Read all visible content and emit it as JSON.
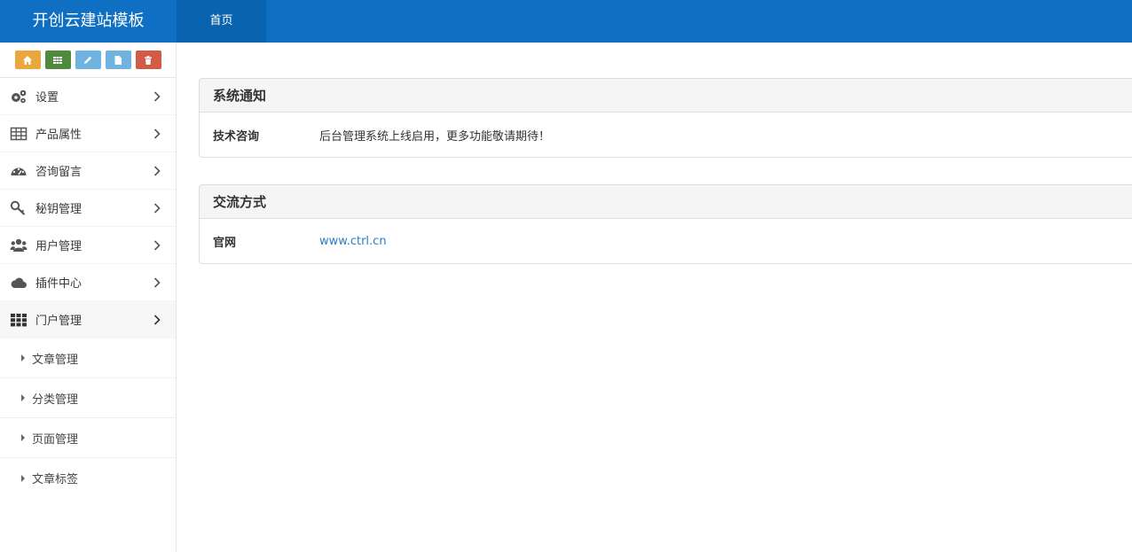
{
  "header": {
    "brand": "开创云建站模板",
    "nav": [
      {
        "label": "首页"
      }
    ]
  },
  "shortcuts": [
    {
      "icon": "home-icon",
      "color": "#e9a73e"
    },
    {
      "icon": "grid-icon",
      "color": "#4f8a3c"
    },
    {
      "icon": "pencil-icon",
      "color": "#6fb3e0"
    },
    {
      "icon": "file-icon",
      "color": "#6fb3e0"
    },
    {
      "icon": "trash-icon",
      "color": "#d15b47"
    }
  ],
  "sidebar": {
    "items": [
      {
        "label": "设置",
        "icon": "gears-icon"
      },
      {
        "label": "产品属性",
        "icon": "table-icon"
      },
      {
        "label": "咨询留言",
        "icon": "dashboard-icon"
      },
      {
        "label": "秘钥管理",
        "icon": "key-icon"
      },
      {
        "label": "用户管理",
        "icon": "users-icon"
      },
      {
        "label": "插件中心",
        "icon": "cloud-icon"
      },
      {
        "label": "门户管理",
        "icon": "th-icon"
      }
    ],
    "subitems": [
      {
        "label": "文章管理"
      },
      {
        "label": "分类管理"
      },
      {
        "label": "页面管理"
      },
      {
        "label": "文章标签"
      }
    ]
  },
  "main": {
    "notice": {
      "title": "系统通知",
      "label": "技术咨询",
      "value": "后台管理系统上线启用，更多功能敬请期待！"
    },
    "contact": {
      "title": "交流方式",
      "label": "官网",
      "link": "www.ctrl.cn"
    }
  }
}
